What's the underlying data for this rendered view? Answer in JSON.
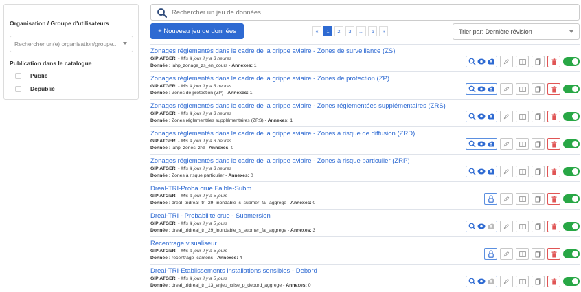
{
  "sidebar": {
    "org_title": "Organisation / Groupe d'utilisateurs",
    "org_placeholder": "Rechercher un(e) organisation/groupe...",
    "publication_title": "Publication dans le catalogue",
    "options": [
      "Publié",
      "Dépublié"
    ]
  },
  "search": {
    "placeholder": "Rechercher un jeu de données"
  },
  "toolbar": {
    "new_label": "+ Nouveau jeu de données",
    "sort_label": "Trier par: Dernière révision"
  },
  "pagination": {
    "prev": "«",
    "pages": [
      "1",
      "2",
      "3",
      "...",
      "6"
    ],
    "next": "»",
    "current": "1"
  },
  "labels": {
    "data": "Donnée :",
    "annexes": "Annexes:"
  },
  "colors": {
    "accent": "#2e6ad2",
    "toggle_on": "#28a745",
    "delete": "#e05555"
  },
  "datasets": [
    {
      "title": "Zonages réglementés dans le cadre de la grippe aviaire - Zones de surveillance (ZS)",
      "org": "GIP ATGERI",
      "updated": "Mis à jour il y a 3 heures",
      "data": "lahp_zonage_zs_en_cours",
      "annexes": "1",
      "actions": "view",
      "published": true
    },
    {
      "title": "Zonages réglementés dans le cadre de la grippe aviaire - Zones de protection (ZP)",
      "org": "GIP ATGERI",
      "updated": "Mis à jour il y a 3 heures",
      "data": "Zones de protection (ZP)",
      "annexes": "1",
      "actions": "view",
      "published": true
    },
    {
      "title": "Zonages réglementés dans le cadre de la grippe aviaire - Zones réglementées supplémentaires (ZRS)",
      "org": "GIP ATGERI",
      "updated": "Mis à jour il y a 3 heures",
      "data": "Zones réglementées supplémentaires (ZRS)",
      "annexes": "1",
      "actions": "view",
      "published": true
    },
    {
      "title": "Zonages réglementés dans le cadre de la grippe aviaire - Zones à risque de diffusion (ZRD)",
      "org": "GIP ATGERI",
      "updated": "Mis à jour il y a 3 heures",
      "data": "iahp_zones_zrd",
      "annexes": "0",
      "actions": "view",
      "published": true
    },
    {
      "title": "Zonages réglementés dans le cadre de la grippe aviaire - Zones à risque particulier (ZRP)",
      "org": "GIP ATGERI",
      "updated": "Mis à jour il y a 3 heures",
      "data": "Zones à risque particulier",
      "annexes": "0",
      "actions": "view",
      "published": true
    },
    {
      "title": "Dreal-TRI-Proba crue Faible-Subm",
      "org": "GIP ATGERI",
      "updated": "Mis à jour il y a 5 jours",
      "data": "dreal_tridreal_tri_29_inondable_s_submer_fai_aggrege",
      "annexes": "0",
      "actions": "lock",
      "published": true
    },
    {
      "title": "Dreal-TRI - Probabilité crue - Submersion",
      "org": "GIP ATGERI",
      "updated": "Mis à jour il y a 5 jours",
      "data": "dreal_tridreal_tri_29_inondable_s_submer_fai_aggrege",
      "annexes": "3",
      "actions": "view-gray",
      "published": true
    },
    {
      "title": "Recentrage visualiseur",
      "org": "GIP ATGERI",
      "updated": "Mis à jour il y a 5 jours",
      "data": "recentrage_cantons",
      "annexes": "4",
      "actions": "lock",
      "published": true
    },
    {
      "title": "Dreal-TRI-Etablissements installations sensibles - Debord",
      "org": "GIP ATGERI",
      "updated": "Mis à jour il y a 5 jours",
      "data": "dreal_tridreal_tri_13_enjeu_crise_p_debord_aggrege",
      "annexes": "0",
      "actions": "view-gray",
      "published": true
    }
  ]
}
